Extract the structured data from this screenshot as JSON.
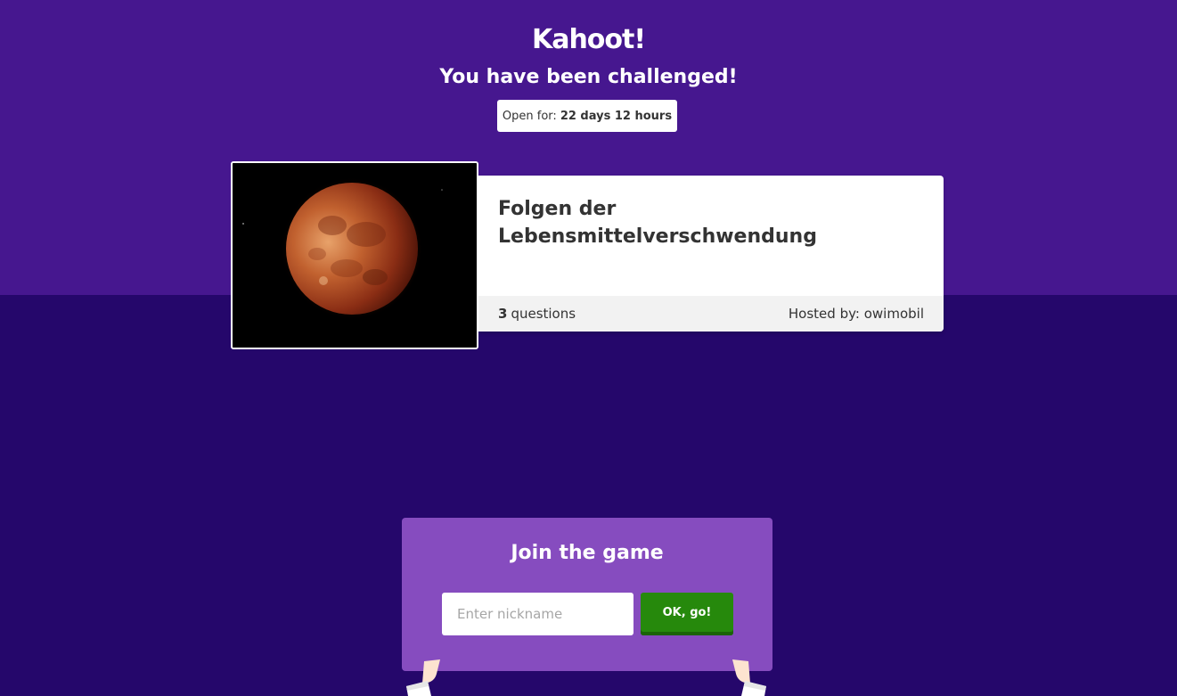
{
  "header": {
    "logo": "Kahoot!",
    "heading": "You have been challenged!",
    "open_for_label": "Open for:",
    "open_for_duration": "22 days 12 hours"
  },
  "kahoot_card": {
    "title": "Folgen der Lebensmittelverschwendung",
    "question_count": "3",
    "question_label": "questions",
    "host_label": "Hosted by:",
    "host_name": "owimobil",
    "cover_image": "lunar-eclipse-red-moon-image"
  },
  "join": {
    "title": "Join the game",
    "nickname_placeholder": "Enter nickname",
    "nickname_value": "",
    "submit_label": "OK, go!"
  },
  "colors": {
    "top_band": "#46178f",
    "bottom_band": "#25076b",
    "join_panel": "#864cbf",
    "go_button": "#26890c"
  }
}
